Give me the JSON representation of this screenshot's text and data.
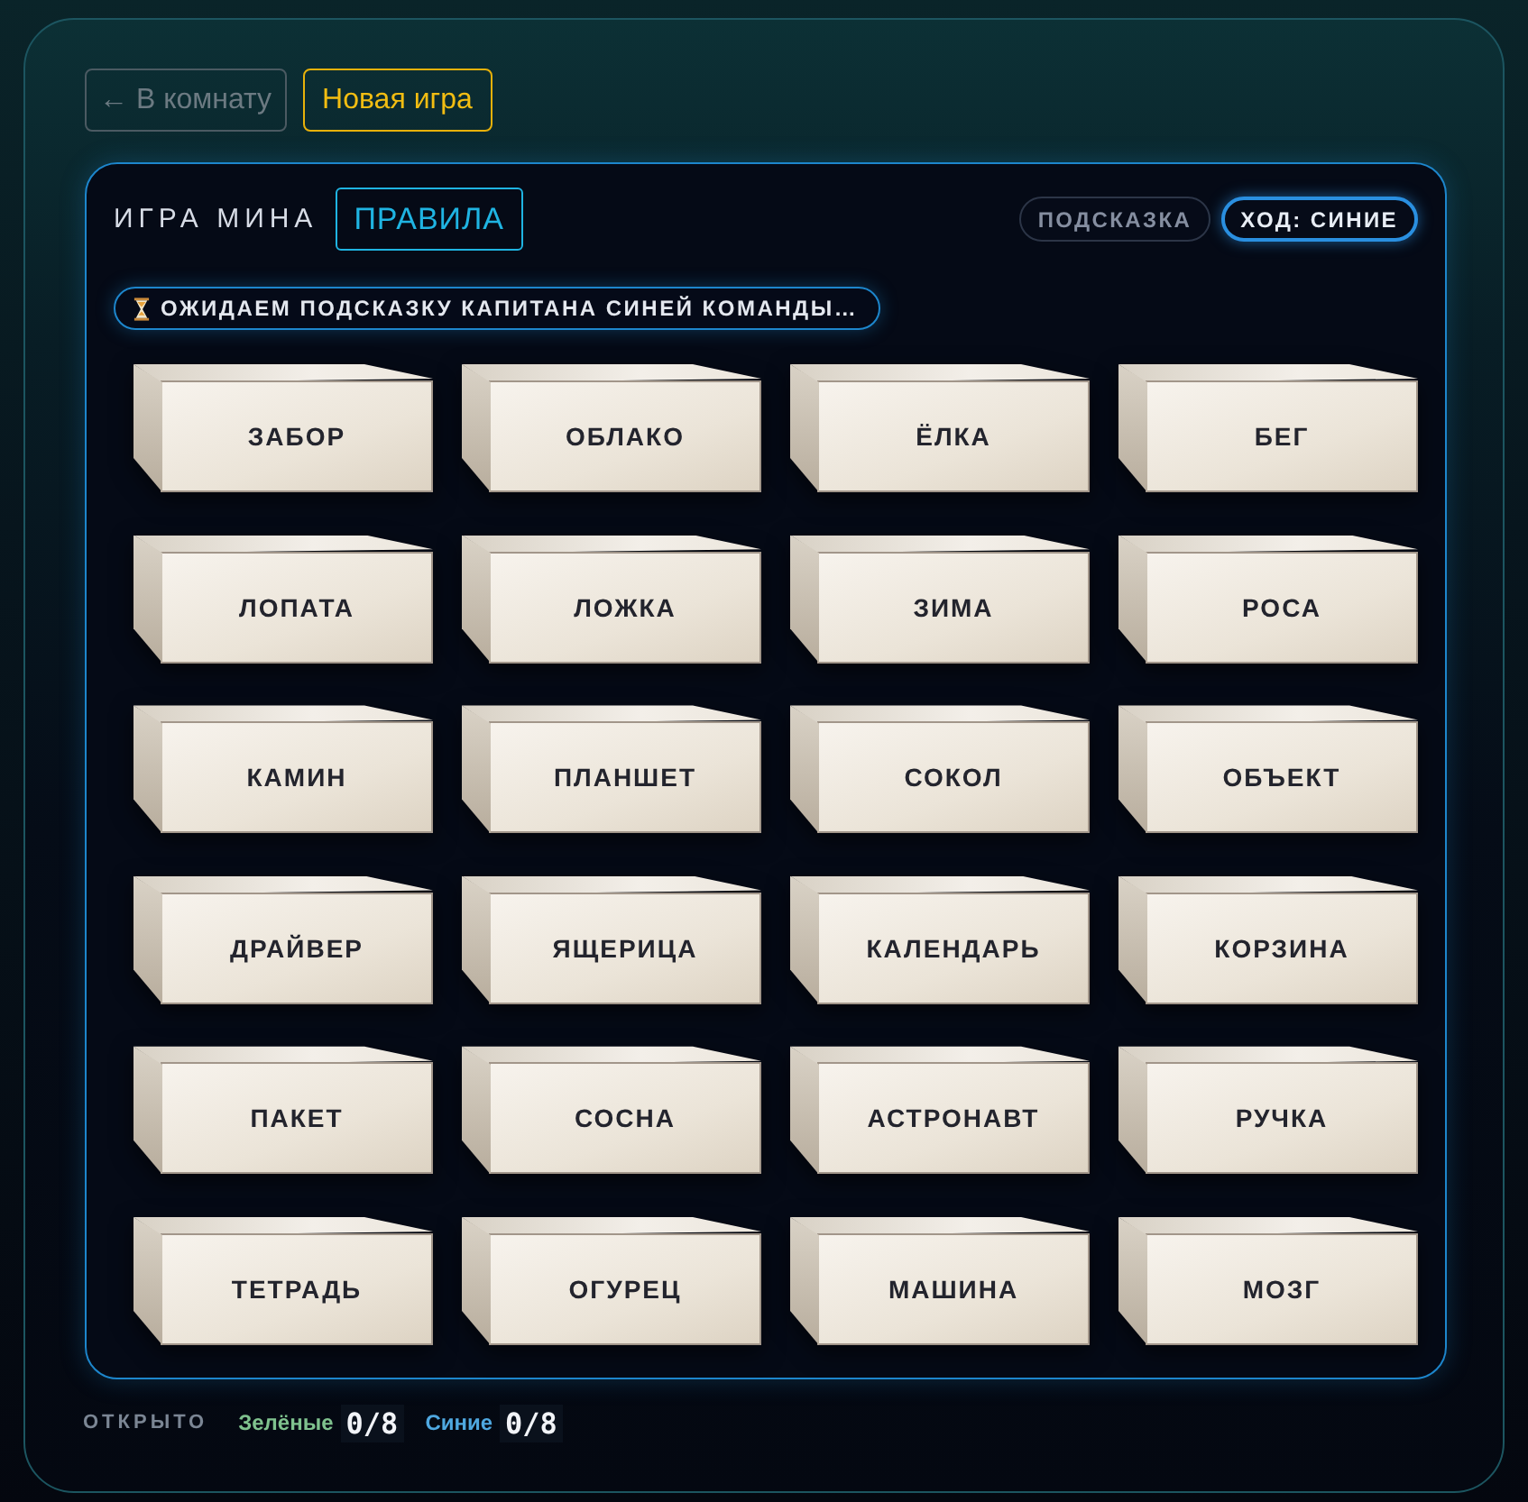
{
  "nav": {
    "buttons": [
      {
        "label": "← В комнату",
        "kind": "back"
      },
      {
        "label": "Новая игра",
        "kind": "primary"
      }
    ]
  },
  "board": {
    "title": "ИГРА МИНА",
    "rules_button": "ПРАВИЛА",
    "hint_button": {
      "label": "ПОДСКАЗКА",
      "disabled": true
    },
    "turn": {
      "label": "ХОД: СИНИЕ",
      "color": "#2a8fe0"
    },
    "status": "ОЖИДАЕМ ПОДСКАЗКУ КАПИТАНА СИНЕЙ КОМАНДЫ…",
    "cards": [
      {
        "word": "ЗАБОР"
      },
      {
        "word": "ОБЛАКО"
      },
      {
        "word": "ЁЛКА"
      },
      {
        "word": "БЕГ"
      },
      {
        "word": "ЛОПАТА"
      },
      {
        "word": "ЛОЖКА"
      },
      {
        "word": "ЗИМА"
      },
      {
        "word": "РОСА"
      },
      {
        "word": "КАМИН"
      },
      {
        "word": "ПЛАНШЕТ"
      },
      {
        "word": "СОКОЛ"
      },
      {
        "word": "ОБЪЕКТ"
      },
      {
        "word": "ДРАЙВЕР"
      },
      {
        "word": "ЯЩЕРИЦА"
      },
      {
        "word": "КАЛЕНДАРЬ"
      },
      {
        "word": "КОРЗИНА"
      },
      {
        "word": "ПАКЕТ"
      },
      {
        "word": "СОСНА"
      },
      {
        "word": "АСТРОНАВТ"
      },
      {
        "word": "РУЧКА"
      },
      {
        "word": "ТЕТРАДЬ"
      },
      {
        "word": "ОГУРЕЦ"
      },
      {
        "word": "МАШИНА"
      },
      {
        "word": "МОЗГ"
      }
    ]
  },
  "footer": {
    "label": "ОТКРЫТО",
    "teams": [
      {
        "name": "Зелёные",
        "score": "0/8",
        "color": "#7fc28e"
      },
      {
        "name": "Синие",
        "score": "0/8",
        "color": "#4fa8e0"
      }
    ]
  }
}
